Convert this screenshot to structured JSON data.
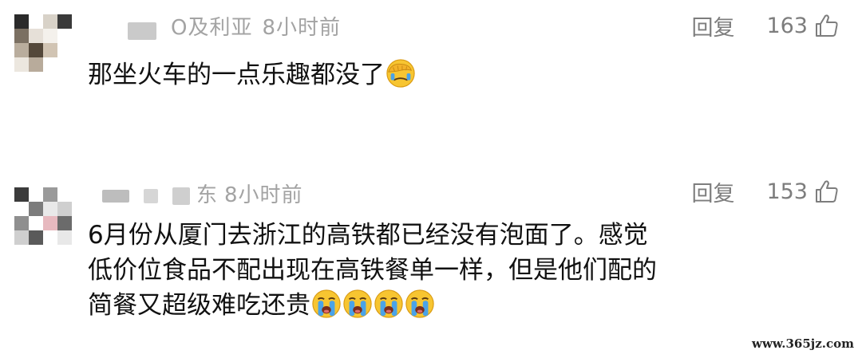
{
  "comments": [
    {
      "user_fragment": "Ο及利亚",
      "time": "8小时前",
      "reply_label": "回复",
      "likes": "163",
      "text_lines": [
        "那坐火车的一点乐趣都没了"
      ],
      "emoji": [
        "facepalm-emoji"
      ]
    },
    {
      "user_fragment": "东",
      "time": "8小时前",
      "reply_label": "回复",
      "likes": "153",
      "text_lines": [
        "6月份从厦门去浙江的高铁都已经没有泡面了。感觉",
        "低价位食品不配出现在高铁餐单一样，但是他们配的",
        "简餐又超级难吃还贵"
      ],
      "emoji": [
        "crying-emoji",
        "crying-emoji",
        "crying-emoji",
        "crying-emoji"
      ]
    }
  ],
  "watermark": "www.365jz.com",
  "colors": {
    "meta_text": "#a3a3a3",
    "action_text": "#7d7d7d",
    "body_text": "#111111"
  }
}
